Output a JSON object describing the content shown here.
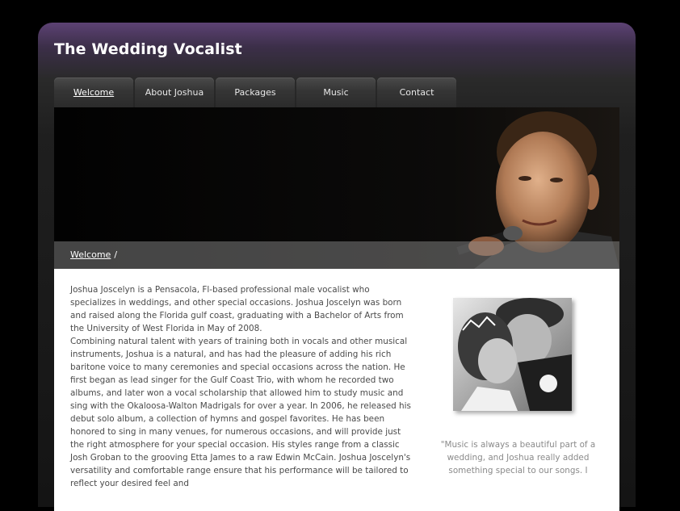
{
  "site": {
    "title": "The Wedding Vocalist"
  },
  "nav": {
    "tabs": [
      {
        "label": "Welcome",
        "active": true
      },
      {
        "label": "About Joshua",
        "active": false
      },
      {
        "label": "Packages",
        "active": false
      },
      {
        "label": "Music",
        "active": false
      },
      {
        "label": "Contact",
        "active": false
      }
    ]
  },
  "breadcrumb": {
    "current": "Welcome",
    "separator": "/"
  },
  "main": {
    "paragraph1": "Joshua Joscelyn is a Pensacola, Fl-based professional male vocalist who specializes in weddings, and other special occasions. Joshua Joscelyn was born and raised along the Florida gulf coast, graduating with a Bachelor of Arts from the University of West Florida in May of 2008.",
    "paragraph2": "Combining natural talent with years of training both in vocals and other musical instruments, Joshua is a natural, and has had the pleasure of adding his rich baritone voice to many ceremonies and special occasions across the nation. He first began as lead singer for the Gulf Coast Trio, with whom he recorded two albums, and later won a vocal scholarship that allowed him to study music and sing with the Okaloosa-Walton Madrigals for over a year. In 2006, he released his debut solo album, a collection of hymns and gospel favorites. He has been honored to sing in many venues, for numerous occasions, and will provide just the right atmosphere for your special occasion. His styles range from a classic Josh Groban to the grooving Etta James to a raw Edwin McCain. Joshua Joscelyn's versatility and comfortable range ensure that his performance will be tailored to reflect your desired feel and"
  },
  "sidebar": {
    "quote": "\"Music is always a beautiful part of a wedding, and Joshua really added something special to our songs. I"
  },
  "colors": {
    "header_purple": "#5d4274",
    "background": "#000000",
    "body_text": "#4a4a4a",
    "quote_text": "#8a8a8a"
  }
}
